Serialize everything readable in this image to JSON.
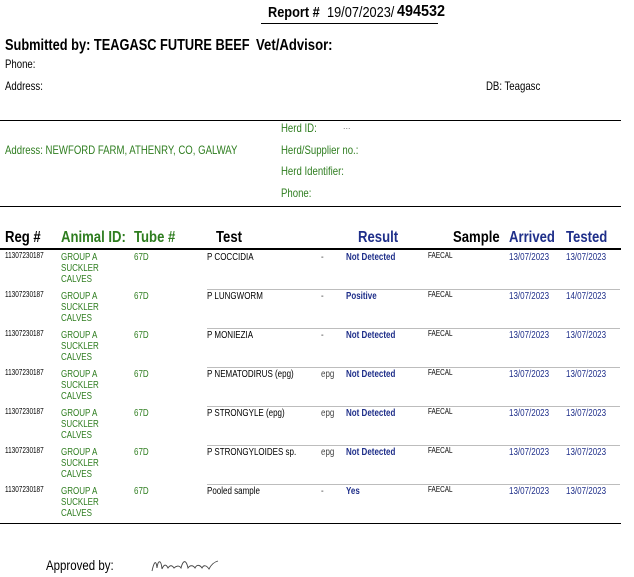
{
  "report": {
    "label": "Report #",
    "date": "19/07/2023/",
    "number": "494532"
  },
  "submitter": {
    "submitted_by": "Submitted by: TEAGASC FUTURE BEEF",
    "vet_advisor": "Vet/Advisor:",
    "phone": "Phone:",
    "address": "Address:",
    "db": "DB: Teagasc"
  },
  "herd": {
    "address": "Address: NEWFORD FARM, ATHENRY, CO, GALWAY",
    "herd_id_label": "Herd ID:",
    "herd_id_value": "...",
    "supplier_label": "Herd/Supplier no.:",
    "identifier_label": "Herd Identifier:",
    "phone_label": "Phone:"
  },
  "table": {
    "headers": [
      "Reg #",
      "Animal ID:",
      "Tube #",
      "Test",
      "Result",
      "Sample",
      "Arrived",
      "Tested"
    ],
    "rows": [
      {
        "reg": "11307230187",
        "animal": "GROUP A SUCKLER CALVES",
        "tube": "67D",
        "test": "P COCCIDIA",
        "unit": "-",
        "result": "Not Detected",
        "sample": "FAECAL",
        "arrived": "13/07/2023",
        "tested": "13/07/2023"
      },
      {
        "reg": "11307230187",
        "animal": "GROUP A SUCKLER CALVES",
        "tube": "67D",
        "test": "P LUNGWORM",
        "unit": "-",
        "result": "Positive",
        "sample": "FAECAL",
        "arrived": "13/07/2023",
        "tested": "14/07/2023"
      },
      {
        "reg": "11307230187",
        "animal": "GROUP A SUCKLER CALVES",
        "tube": "67D",
        "test": "P MONIEZIA",
        "unit": "-",
        "result": "Not Detected",
        "sample": "FAECAL",
        "arrived": "13/07/2023",
        "tested": "13/07/2023"
      },
      {
        "reg": "11307230187",
        "animal": "GROUP A SUCKLER CALVES",
        "tube": "67D",
        "test": "P NEMATODIRUS (epg)",
        "unit": "epg",
        "result": "Not Detected",
        "sample": "FAECAL",
        "arrived": "13/07/2023",
        "tested": "13/07/2023"
      },
      {
        "reg": "11307230187",
        "animal": "GROUP A SUCKLER CALVES",
        "tube": "67D",
        "test": "P STRONGYLE (epg)",
        "unit": "epg",
        "result": "Not Detected",
        "sample": "FAECAL",
        "arrived": "13/07/2023",
        "tested": "13/07/2023"
      },
      {
        "reg": "11307230187",
        "animal": "GROUP A SUCKLER CALVES",
        "tube": "67D",
        "test": "P STRONGYLOIDES sp.",
        "unit": "epg",
        "result": "Not Detected",
        "sample": "FAECAL",
        "arrived": "13/07/2023",
        "tested": "13/07/2023"
      },
      {
        "reg": "11307230187",
        "animal": "GROUP A SUCKLER CALVES",
        "tube": "67D",
        "test": "Pooled sample",
        "unit": "-",
        "result": "Yes",
        "sample": "FAECAL",
        "arrived": "13/07/2023",
        "tested": "13/07/2023"
      }
    ]
  },
  "footer": {
    "approved_by": "Approved by:"
  },
  "colors": {
    "green": "#2e7d1f",
    "navy": "#1f2f8a"
  }
}
